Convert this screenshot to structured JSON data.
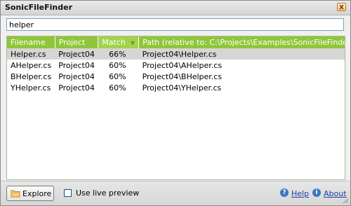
{
  "window": {
    "title": "SonicFileFinder"
  },
  "search": {
    "value": "helper"
  },
  "results": {
    "columns": [
      "Filename",
      "Project",
      "Match",
      "Path (relative to: C:\\Projects\\Examples\\SonicFileFinderDemo\\)"
    ],
    "sorted_column": "Match",
    "rows": [
      {
        "filename": "Helper.cs",
        "project": "Project04",
        "match": "66%",
        "path": "Project04\\Helper.cs",
        "selected": true
      },
      {
        "filename": "AHelper.cs",
        "project": "Project04",
        "match": "60%",
        "path": "Project04\\AHelper.cs",
        "selected": false
      },
      {
        "filename": "BHelper.cs",
        "project": "Project04",
        "match": "60%",
        "path": "Project04\\BHelper.cs",
        "selected": false
      },
      {
        "filename": "YHelper.cs",
        "project": "Project04",
        "match": "60%",
        "path": "Project04\\YHelper.cs",
        "selected": false
      }
    ]
  },
  "bottom": {
    "explore_label": "Explore",
    "live_preview_label": "Use live preview",
    "live_preview_checked": false,
    "help_label": "Help",
    "about_label": "About"
  },
  "colors": {
    "header_green": "#8fc63b",
    "selected_row": "#d6d6d6",
    "link_blue": "#1a3fa8"
  },
  "icons": {
    "close": "close-icon",
    "folder": "folder-icon",
    "help": "help-icon",
    "about": "info-icon",
    "sort": "sort-desc-icon"
  }
}
